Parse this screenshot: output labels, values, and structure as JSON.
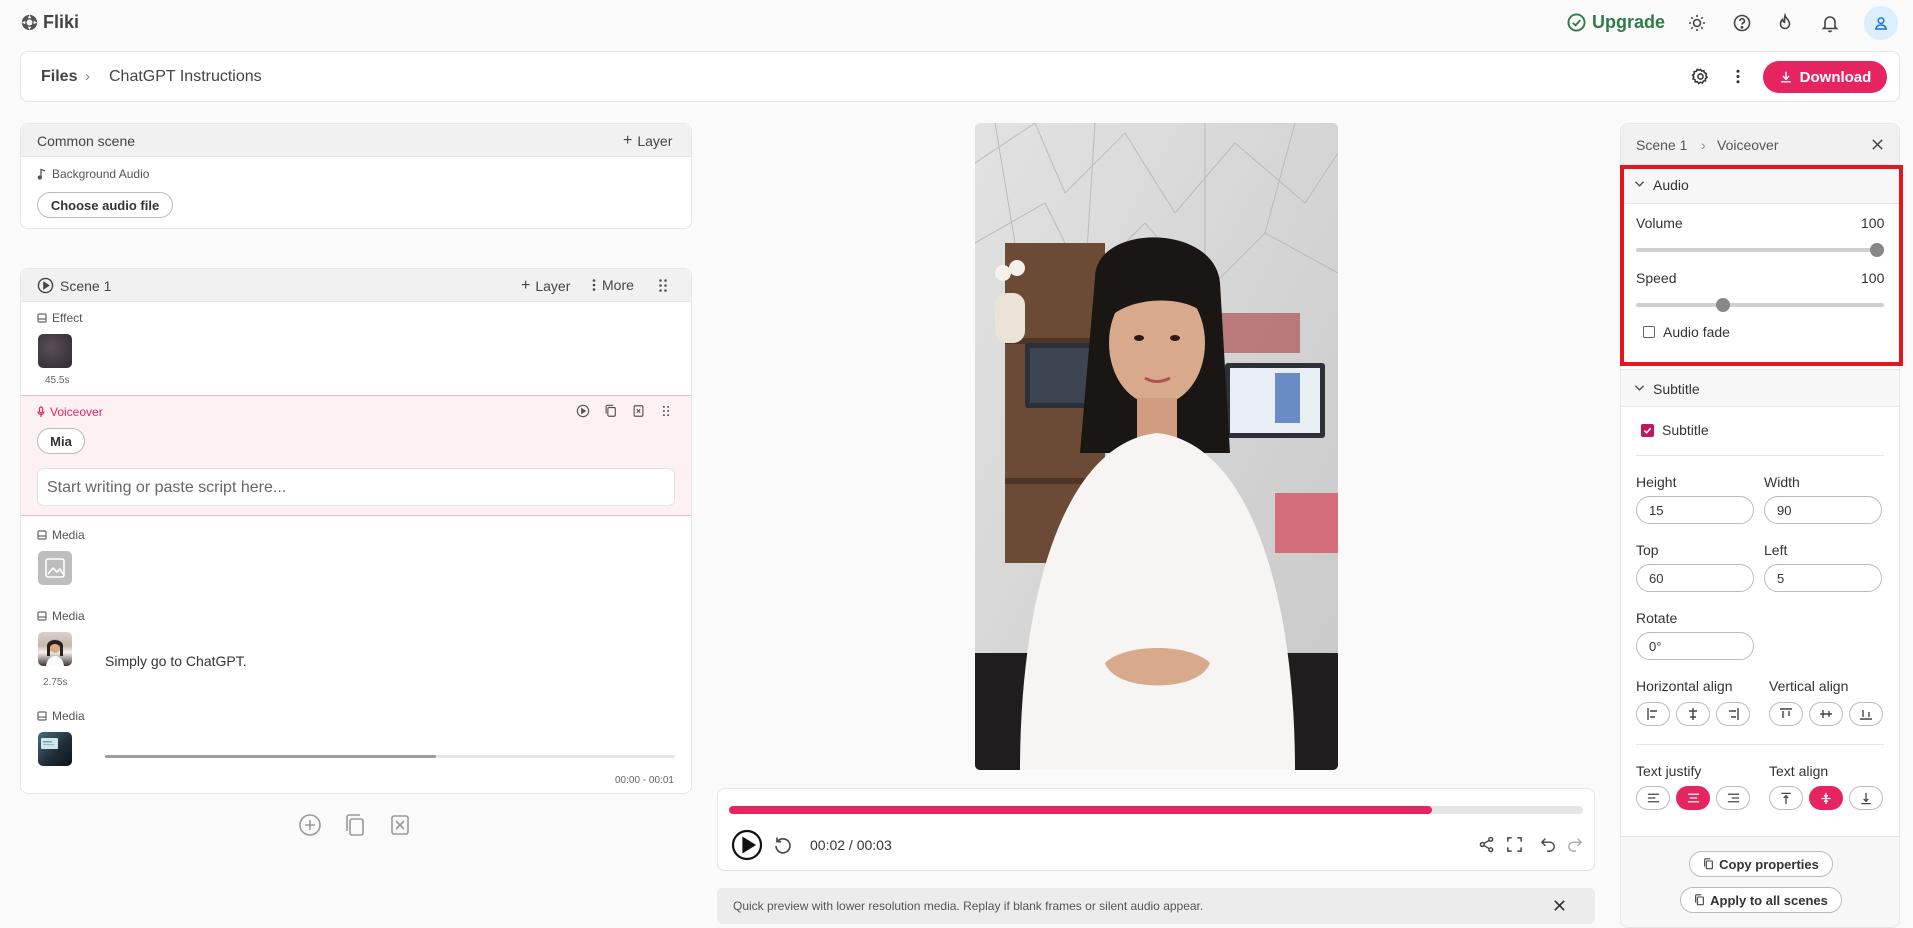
{
  "app": {
    "name": "Fliki"
  },
  "topbar": {
    "upgrade_label": "Upgrade"
  },
  "breadcrumb": {
    "root": "Files",
    "sep": "›",
    "current": "ChatGPT Instructions"
  },
  "toolbar": {
    "download_label": "Download"
  },
  "common_scene": {
    "title": "Common scene",
    "layer_label": "Layer",
    "bg_audio_label": "Background Audio",
    "choose_audio_label": "Choose audio file"
  },
  "scene1": {
    "title": "Scene 1",
    "layer_label": "Layer",
    "more_label": "More",
    "effect_label": "Effect",
    "effect_duration": "45.5s",
    "voiceover_label": "Voiceover",
    "voice_name": "Mia",
    "script_placeholder": "Start writing or paste script here...",
    "media": [
      {
        "label": "Media"
      },
      {
        "label": "Media",
        "duration": "2.75s",
        "text": "Simply go to ChatGPT."
      },
      {
        "label": "Media",
        "range": "00:00 - 00:01",
        "progress": 0.58
      }
    ]
  },
  "player": {
    "time": "00:02 / 00:03",
    "progress": 0.823,
    "notice": "Quick preview with lower resolution media. Replay if blank frames or silent audio appear."
  },
  "right_panel": {
    "crumb_scene": "Scene 1",
    "crumb_sep": "›",
    "crumb_item": "Voiceover",
    "audio": {
      "title": "Audio",
      "volume_label": "Volume",
      "volume_value": "100",
      "volume_level": 1.0,
      "speed_label": "Speed",
      "speed_value": "100",
      "speed_level": 0.34,
      "fade_label": "Audio fade",
      "fade_checked": false
    },
    "subtitle": {
      "title": "Subtitle",
      "enabled_label": "Subtitle",
      "enabled": true,
      "height_label": "Height",
      "height_value": "15",
      "width_label": "Width",
      "width_value": "90",
      "top_label": "Top",
      "top_value": "60",
      "left_label": "Left",
      "left_value": "5",
      "rotate_label": "Rotate",
      "rotate_value": "0°",
      "h_align_label": "Horizontal align",
      "v_align_label": "Vertical align",
      "text_justify_label": "Text justify",
      "text_align_label": "Text align"
    },
    "copy_properties_label": "Copy properties",
    "apply_all_label": "Apply to all scenes"
  },
  "colors": {
    "accent": "#e6245f",
    "upgrade": "#2e7d46",
    "highlight": "#e3151d"
  }
}
